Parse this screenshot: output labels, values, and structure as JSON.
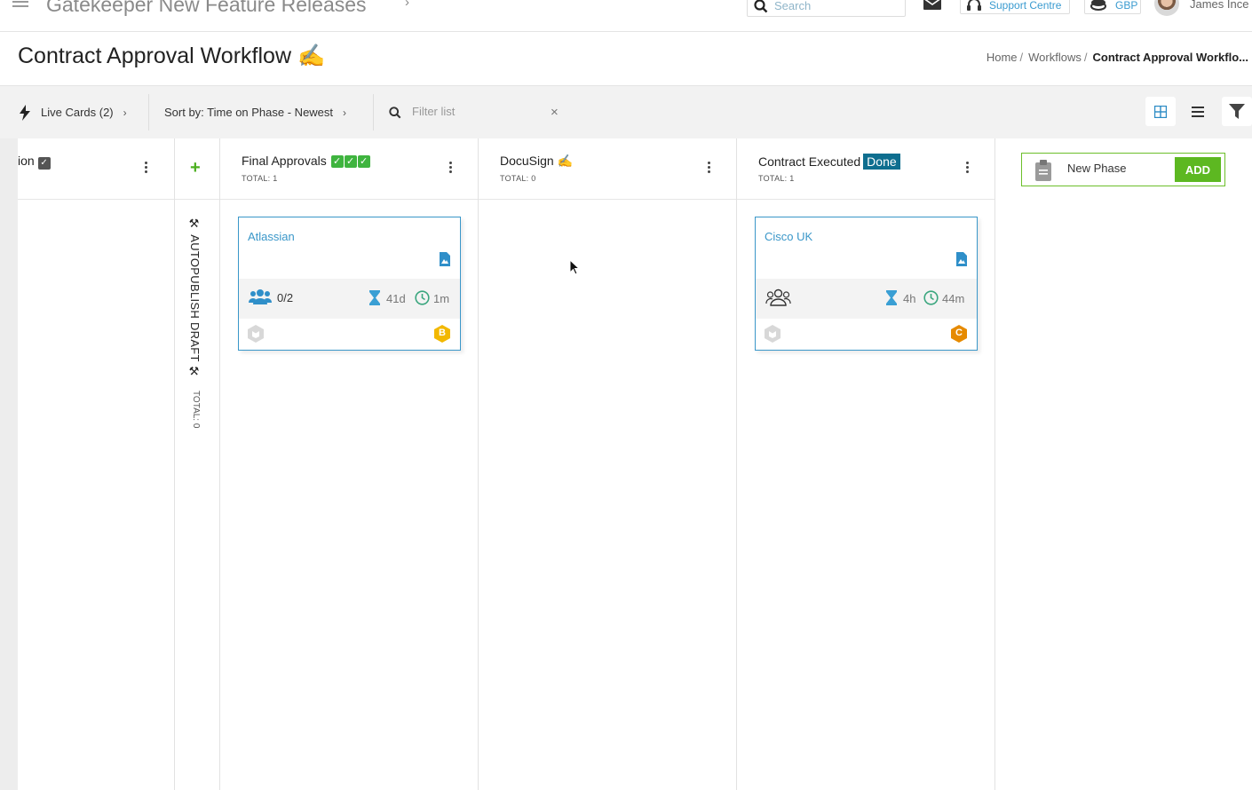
{
  "topbar": {
    "app_title": "Gatekeeper New Feature Releases",
    "search_placeholder": "Search",
    "support_label": "Support Centre",
    "currency_label": "GBP",
    "user_name": "James Ince"
  },
  "header": {
    "page_title": "Contract Approval Workflow ✍️",
    "breadcrumb": [
      {
        "label": "Home",
        "sep": "/"
      },
      {
        "label": "Workflows",
        "sep": "/"
      },
      {
        "label": "Contract Approval Workflo..."
      }
    ]
  },
  "toolbar": {
    "live_cards_label": "Live Cards (2)",
    "sort_label": "Sort by: Time on Phase - Newest",
    "filter_placeholder": "Filter list",
    "clear_label": "×"
  },
  "board": {
    "partial_column": {
      "name": "ion",
      "badge": "✓"
    },
    "add_phase_symbol": "+",
    "vertical_phase": {
      "name": "AUTOPUBLISH DRAFT",
      "total": "TOTAL: 0"
    },
    "columns": [
      {
        "name": "Final Approvals",
        "checks": [
          "✓",
          "✓",
          "✓"
        ],
        "total": "TOTAL: 1",
        "card": {
          "title": "Atlassian",
          "people": "0/2",
          "time_on_phase": "41d",
          "last_activity": "1m",
          "grade": "B",
          "grade_color": "#f2b800"
        }
      },
      {
        "name": "DocuSign ✍️",
        "total": "TOTAL: 0"
      },
      {
        "name": "Contract Executed",
        "badge": "Done",
        "total": "TOTAL: 1",
        "card": {
          "title": "Cisco UK",
          "time_on_phase": "4h",
          "last_activity": "44m",
          "grade": "C",
          "grade_color": "#e68a00"
        }
      }
    ],
    "new_phase": {
      "placeholder": "New Phase",
      "add_label": "ADD"
    }
  },
  "colors": {
    "accent_blue": "#3a97c9",
    "done_badge": "#0e6e8f",
    "add_green": "#5db821",
    "check_green": "#3fb43f"
  }
}
